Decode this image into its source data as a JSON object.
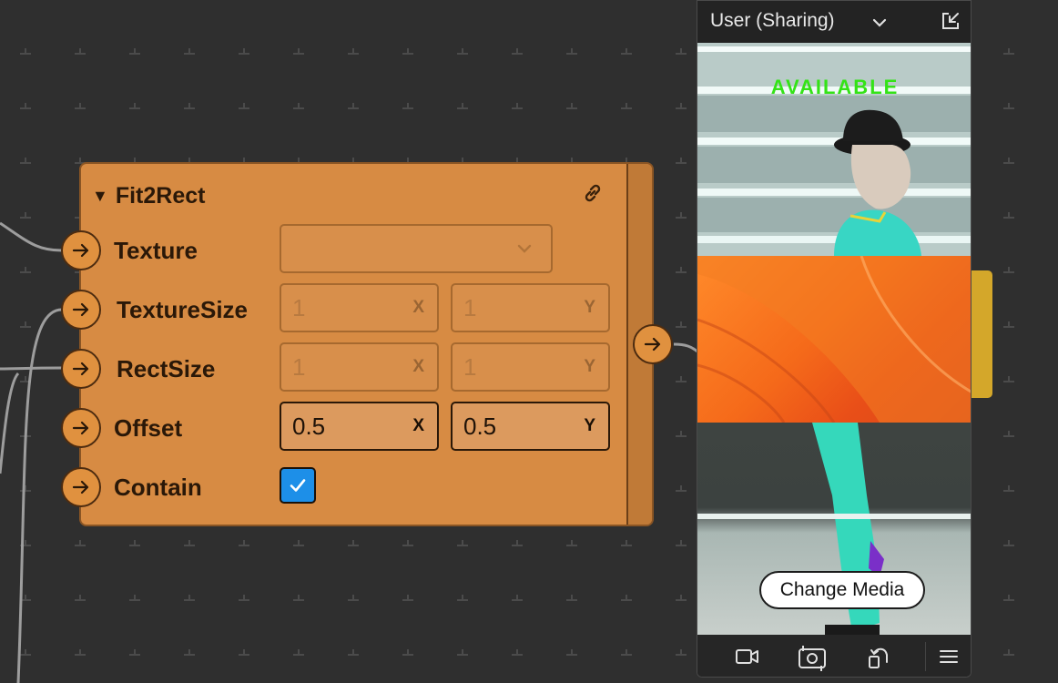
{
  "node": {
    "title": "Fit2Rect",
    "inputs": [
      {
        "label": "Texture"
      },
      {
        "label": "TextureSize",
        "x": "1",
        "y": "1",
        "x_axis": "X",
        "y_axis": "Y"
      },
      {
        "label": "RectSize",
        "x": "1",
        "y": "1",
        "x_axis": "X",
        "y_axis": "Y"
      },
      {
        "label": "Offset",
        "x": "0.5",
        "y": "0.5",
        "x_axis": "X",
        "y_axis": "Y"
      },
      {
        "label": "Contain",
        "checked": true
      }
    ]
  },
  "video_panel": {
    "title": "User (Sharing)",
    "overlay_text": "AVAILABLE",
    "change_media_label": "Change Media"
  },
  "colors": {
    "canvas": "#2f2f2f",
    "node": "#d78b43",
    "checkbox": "#1d8fe8",
    "available": "#33e316",
    "yellow_tab": "#d4a72a"
  }
}
